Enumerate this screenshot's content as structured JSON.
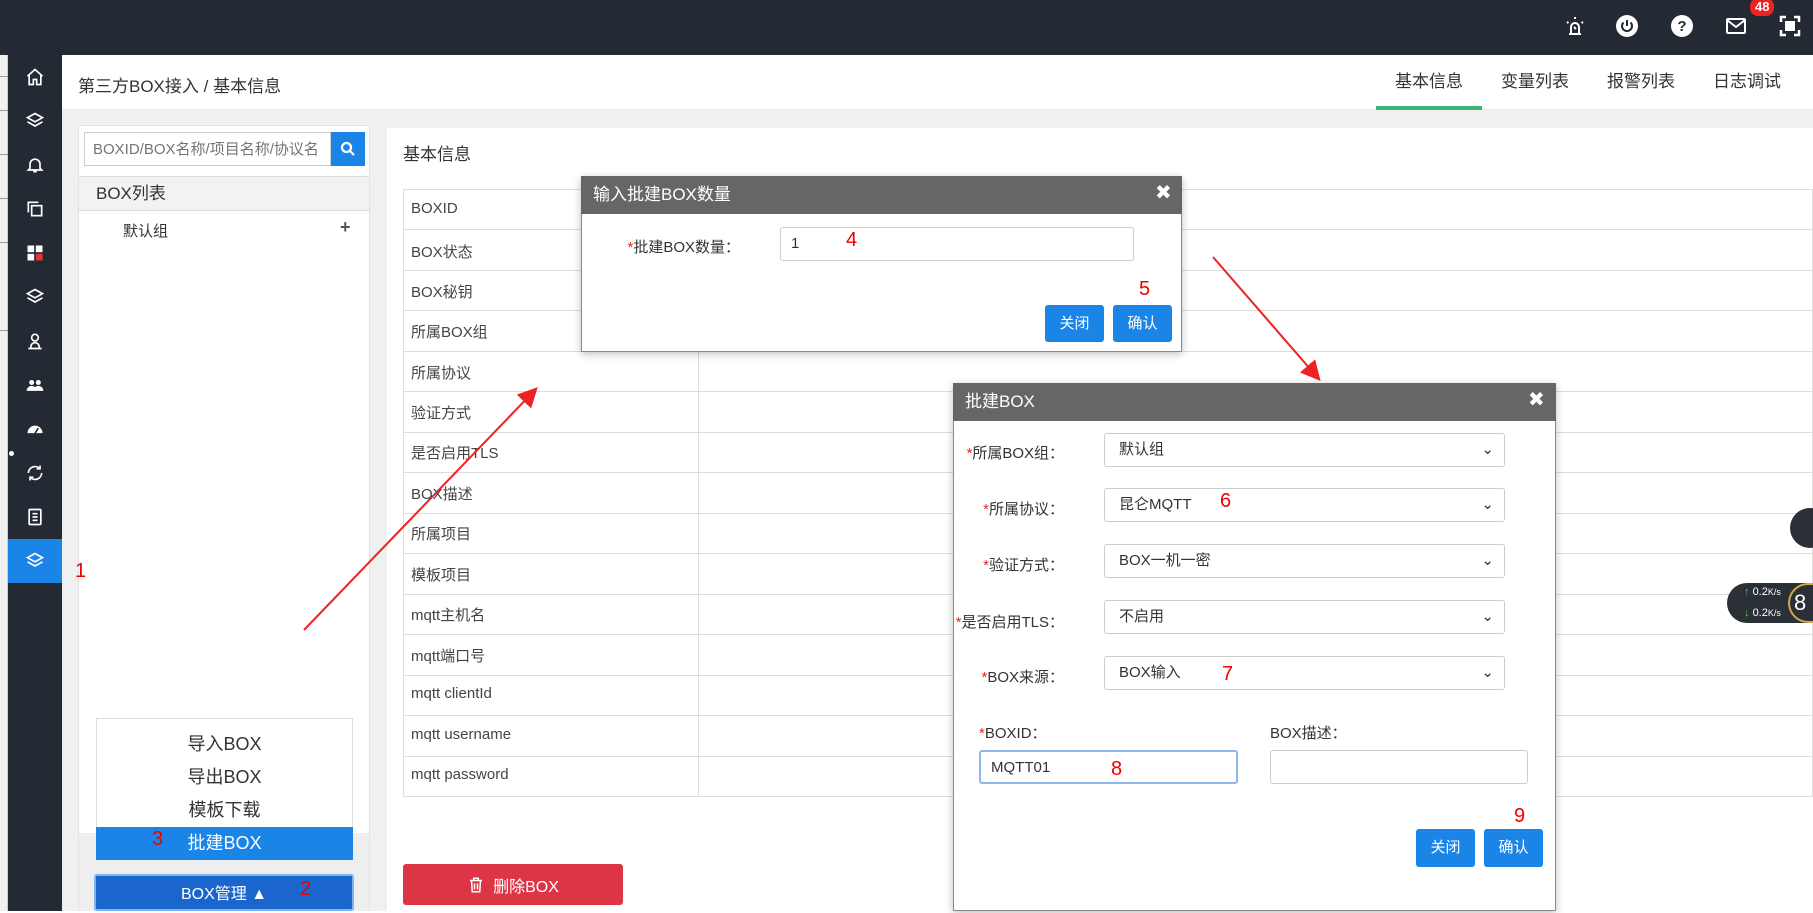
{
  "header": {
    "breadcrumb": "第三方BOX接入 / 基本信息",
    "tabs": [
      {
        "label": "基本信息",
        "active": true
      },
      {
        "label": "变量列表",
        "active": false
      },
      {
        "label": "报警列表",
        "active": false
      },
      {
        "label": "日志调试",
        "active": false
      }
    ],
    "mail_badge": "48",
    "accent_color": "#3cb371"
  },
  "left_panel": {
    "search_placeholder": "BOXID/BOX名称/项目名称/协议名",
    "list_title": "BOX列表",
    "default_group": "默认组",
    "add_icon": "plus-icon",
    "menu": [
      "导入BOX",
      "导出BOX",
      "模板下载",
      "批建BOX"
    ],
    "box_manage_button": "BOX管理 ▲"
  },
  "main": {
    "title": "基本信息",
    "rows": [
      "BOXID",
      "BOX状态",
      "BOX秘钥",
      "所属BOX组",
      "所属协议",
      "验证方式",
      "是否启用TLS",
      "BOX描述",
      "所属项目",
      "模板项目",
      "mqtt主机名",
      "mqtt端口号",
      "mqtt clientId",
      "mqtt username",
      "mqtt password"
    ],
    "delete_button": "删除BOX",
    "delete_color": "#dc3545"
  },
  "dialog_count": {
    "title": "输入批建BOX数量",
    "label": "批建BOX数量：",
    "value": "1",
    "close_button": "关闭",
    "confirm_button": "确认"
  },
  "dialog_batch": {
    "title": "批建BOX",
    "fields": [
      {
        "label": "所属BOX组：",
        "value": "默认组"
      },
      {
        "label": "所属协议：",
        "value": "昆仑MQTT"
      },
      {
        "label": "验证方式：",
        "value": "BOX一机一密"
      },
      {
        "label": "是否启用TLS：",
        "value": "不启用"
      },
      {
        "label": "BOX来源：",
        "value": "BOX输入"
      }
    ],
    "boxid_label": "BOXID：",
    "boxid_value": "MQTT01",
    "desc_label": "BOX描述：",
    "close_button": "关闭",
    "confirm_button": "确认"
  },
  "annotations": [
    "1",
    "2",
    "3",
    "4",
    "5",
    "6",
    "7",
    "8",
    "9"
  ],
  "net_widget": {
    "up": "0.2",
    "down": "0.2",
    "unit": "K/s",
    "ring": "8"
  },
  "primary_color": "#1a85e6"
}
